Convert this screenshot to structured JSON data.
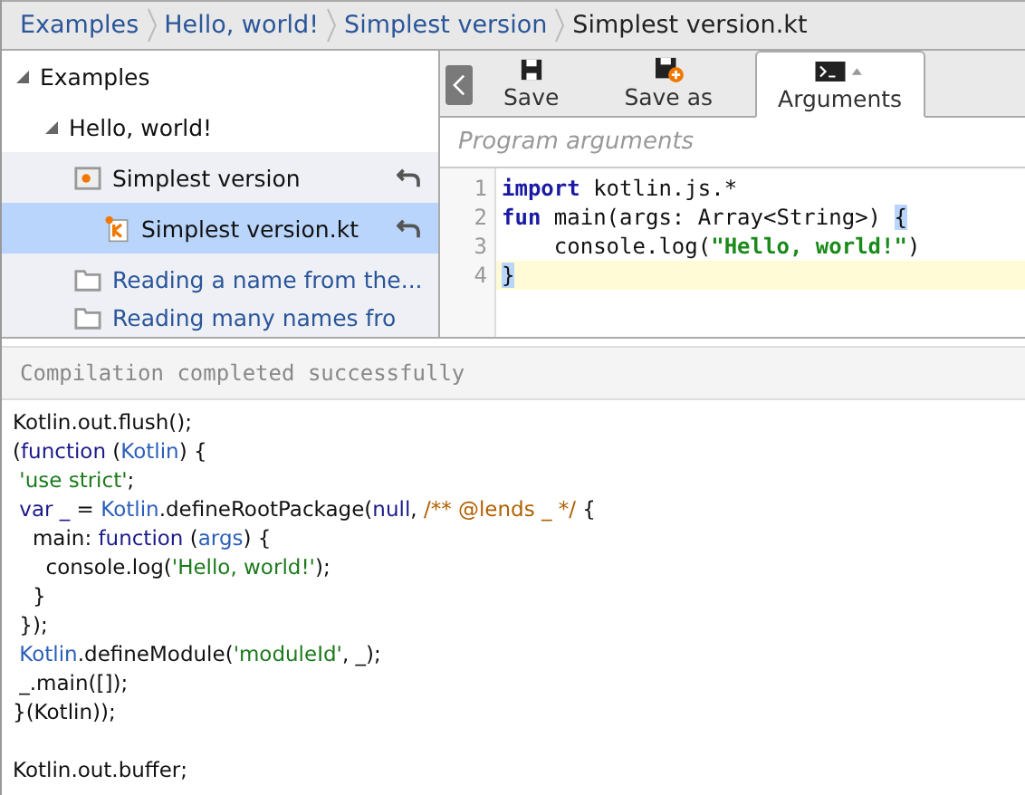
{
  "breadcrumbs": [
    {
      "label": "Examples",
      "current": false
    },
    {
      "label": "Hello, world!",
      "current": false
    },
    {
      "label": "Simplest version",
      "current": false
    },
    {
      "label": "Simplest version.kt",
      "current": true
    }
  ],
  "tree": [
    {
      "label": "Examples",
      "kind": "group",
      "expanded": true,
      "children": [
        {
          "label": "Hello, world!",
          "kind": "group",
          "expanded": true,
          "children": [
            {
              "label": "Simplest version",
              "kind": "folder",
              "modified": true,
              "selected": false,
              "children": [
                {
                  "label": "Simplest version.kt",
                  "kind": "kotlin-file",
                  "modified": true,
                  "selected": true
                }
              ]
            },
            {
              "label": "Reading a name from the...",
              "kind": "link-folder",
              "modified": false,
              "selected": false
            },
            {
              "label": "Reading many names fro",
              "kind": "link-folder",
              "modified": false,
              "selected": false
            }
          ]
        }
      ]
    }
  ],
  "toolbar": [
    {
      "label": "Save",
      "kind": "save",
      "selected": false
    },
    {
      "label": "Save as",
      "kind": "save-as",
      "selected": false
    },
    {
      "label": "Arguments",
      "kind": "arguments",
      "selected": true
    }
  ],
  "arguments": {
    "placeholder": "Program arguments"
  },
  "editor": {
    "lines": [
      {
        "number": "1",
        "current": false,
        "tokens": [
          {
            "text": "import",
            "kind": "keyword"
          },
          {
            "text": " kotlin.js.*",
            "kind": "plain"
          }
        ]
      },
      {
        "number": "2",
        "current": false,
        "tokens": [
          {
            "text": "fun",
            "kind": "keyword"
          },
          {
            "text": " main(args: Array<String>) ",
            "kind": "plain"
          },
          {
            "text": "{",
            "kind": "match"
          }
        ]
      },
      {
        "number": "3",
        "current": false,
        "tokens": [
          {
            "text": "    console.log(",
            "kind": "plain"
          },
          {
            "text": "\"Hello, world!\"",
            "kind": "string"
          },
          {
            "text": ")",
            "kind": "plain"
          }
        ]
      },
      {
        "number": "4",
        "current": true,
        "tokens": [
          {
            "text": "}",
            "kind": "match"
          }
        ]
      }
    ]
  },
  "console": {
    "status": "Compilation completed successfully",
    "lines": [
      [
        {
          "text": "Kotlin.out.flush();",
          "kind": "plain"
        }
      ],
      [
        {
          "text": "(",
          "kind": "plain"
        },
        {
          "text": "function",
          "kind": "keyword"
        },
        {
          "text": " (",
          "kind": "plain"
        },
        {
          "text": "Kotlin",
          "kind": "variable"
        },
        {
          "text": ") {",
          "kind": "plain"
        }
      ],
      [
        {
          "text": " 'use strict'",
          "kind": "string"
        },
        {
          "text": ";",
          "kind": "plain"
        }
      ],
      [
        {
          "text": " var _",
          "kind": "keyword"
        },
        {
          "text": " = ",
          "kind": "plain"
        },
        {
          "text": "Kotlin",
          "kind": "variable"
        },
        {
          "text": ".defineRootPackage(",
          "kind": "plain"
        },
        {
          "text": "null",
          "kind": "keyword"
        },
        {
          "text": ", ",
          "kind": "plain"
        },
        {
          "text": "/** @lends _ */",
          "kind": "comment"
        },
        {
          "text": " {",
          "kind": "plain"
        }
      ],
      [
        {
          "text": "   main: ",
          "kind": "plain"
        },
        {
          "text": "function",
          "kind": "keyword"
        },
        {
          "text": " (",
          "kind": "plain"
        },
        {
          "text": "args",
          "kind": "variable"
        },
        {
          "text": ") {",
          "kind": "plain"
        }
      ],
      [
        {
          "text": "     console.log(",
          "kind": "plain"
        },
        {
          "text": "'Hello, world!'",
          "kind": "string"
        },
        {
          "text": ");",
          "kind": "plain"
        }
      ],
      [
        {
          "text": "   }",
          "kind": "plain"
        }
      ],
      [
        {
          "text": " });",
          "kind": "plain"
        }
      ],
      [
        {
          "text": " Kotlin",
          "kind": "variable"
        },
        {
          "text": ".defineModule(",
          "kind": "plain"
        },
        {
          "text": "'moduleId'",
          "kind": "string"
        },
        {
          "text": ", _);",
          "kind": "plain"
        }
      ],
      [
        {
          "text": " _.main([]);",
          "kind": "plain"
        }
      ],
      [
        {
          "text": "}(Kotlin));",
          "kind": "plain"
        }
      ],
      [
        {
          "text": "Kotlin.out.buffer;",
          "kind": "plain",
          "blank_before": true
        }
      ]
    ]
  }
}
